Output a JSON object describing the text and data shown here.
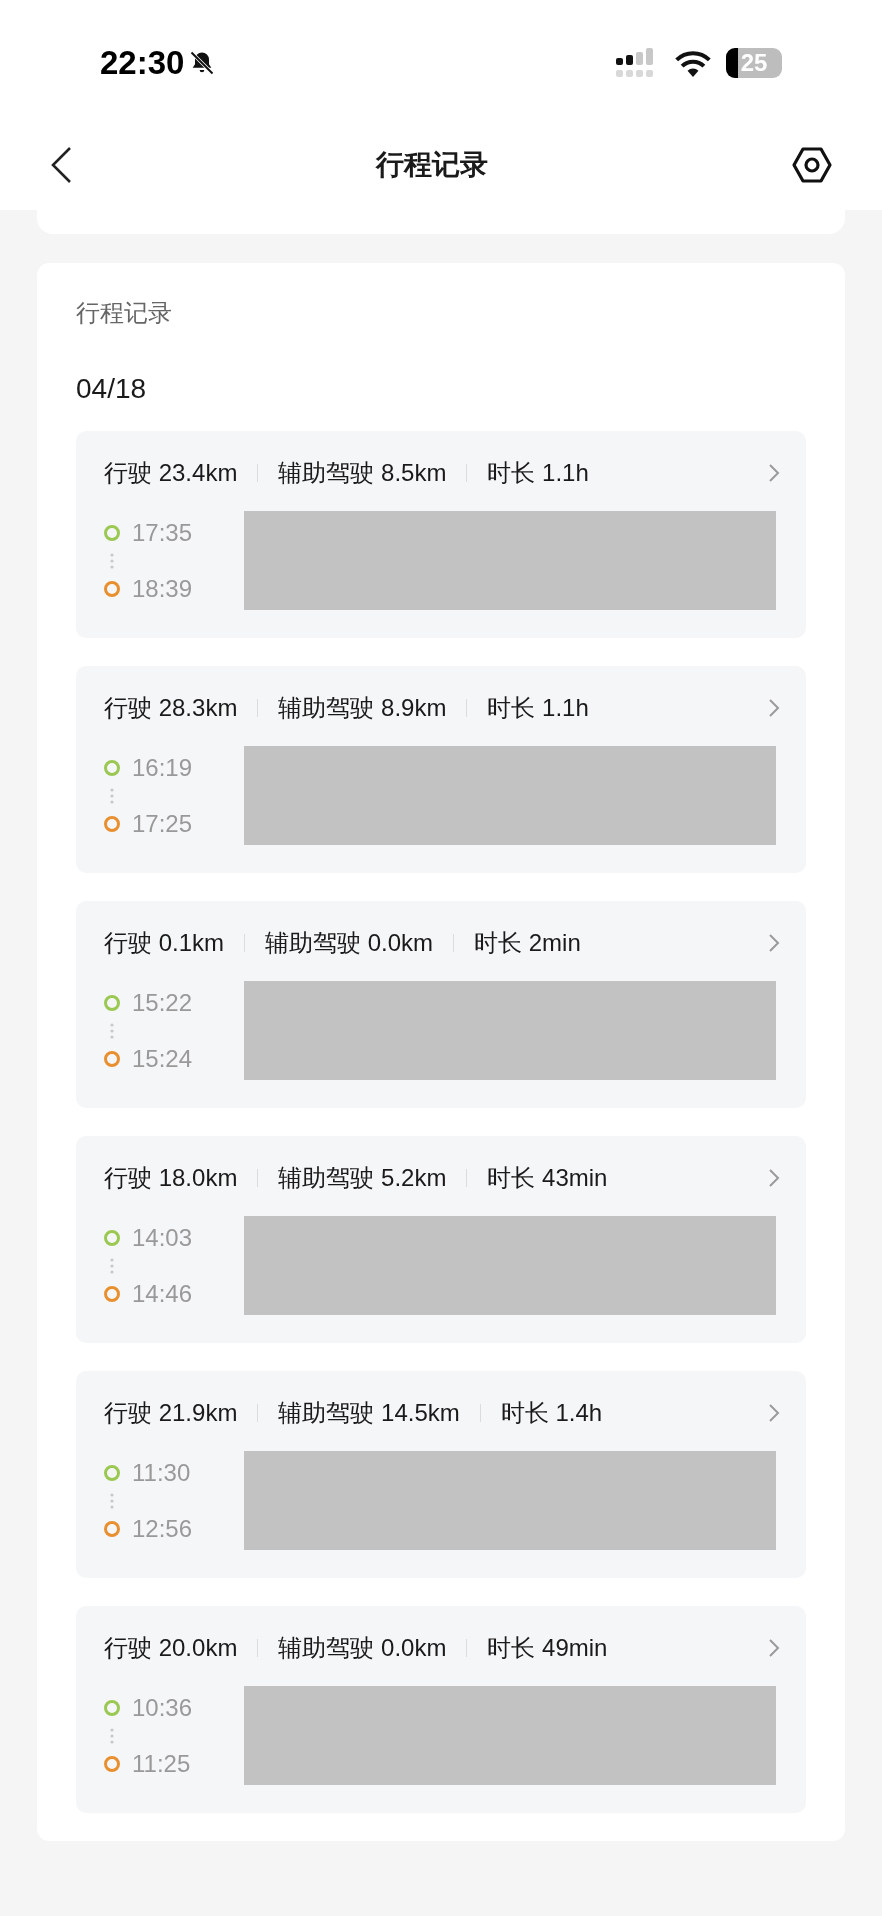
{
  "status_bar": {
    "time": "22:30",
    "battery": "25"
  },
  "header": {
    "title": "行程记录"
  },
  "section": {
    "title": "行程记录",
    "date": "04/18"
  },
  "trips": [
    {
      "distance": "行驶 23.4km",
      "assisted": "辅助驾驶 8.5km",
      "duration": "时长 1.1h",
      "start": "17:35",
      "end": "18:39"
    },
    {
      "distance": "行驶 28.3km",
      "assisted": "辅助驾驶 8.9km",
      "duration": "时长 1.1h",
      "start": "16:19",
      "end": "17:25"
    },
    {
      "distance": "行驶 0.1km",
      "assisted": "辅助驾驶 0.0km",
      "duration": "时长 2min",
      "start": "15:22",
      "end": "15:24"
    },
    {
      "distance": "行驶 18.0km",
      "assisted": "辅助驾驶 5.2km",
      "duration": "时长 43min",
      "start": "14:03",
      "end": "14:46"
    },
    {
      "distance": "行驶 21.9km",
      "assisted": "辅助驾驶 14.5km",
      "duration": "时长 1.4h",
      "start": "11:30",
      "end": "12:56"
    },
    {
      "distance": "行驶 20.0km",
      "assisted": "辅助驾驶 0.0km",
      "duration": "时长 49min",
      "start": "10:36",
      "end": "11:25"
    }
  ]
}
